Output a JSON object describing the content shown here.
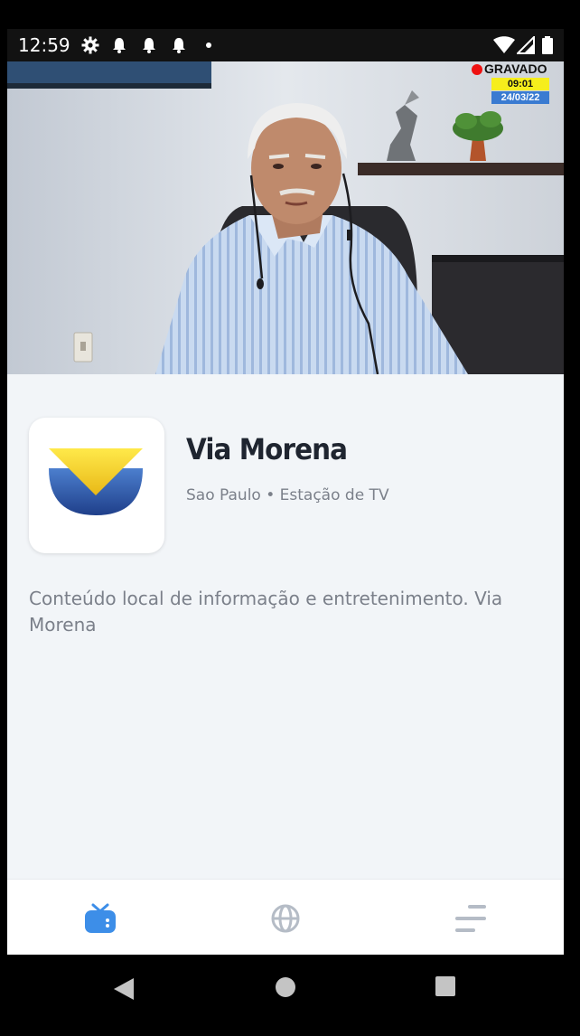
{
  "status_bar": {
    "time": "12:59",
    "icons": [
      "gear-icon",
      "bell-icon",
      "bell-icon",
      "bell-icon",
      "dot-icon",
      "wifi-icon",
      "signal-icon",
      "battery-icon"
    ]
  },
  "video": {
    "overlay": {
      "recording_label": "GRAVADO",
      "time": "09:01",
      "date": "24/03/22"
    }
  },
  "station": {
    "name": "Via Morena",
    "subtitle": "Sao Paulo • Estação de TV",
    "description": "Conteúdo local de informação e entretenimento. Via Morena"
  },
  "bottom_nav": {
    "items": [
      {
        "icon": "tv-icon",
        "active": true
      },
      {
        "icon": "globe-icon",
        "active": false
      },
      {
        "icon": "menu-lines-icon",
        "active": false
      }
    ]
  },
  "colors": {
    "accent": "#3d8ee8",
    "inactive_icon": "#b5bcc6",
    "logo_yellow": "#f3d21c",
    "logo_blue": "#2f5aa8"
  }
}
